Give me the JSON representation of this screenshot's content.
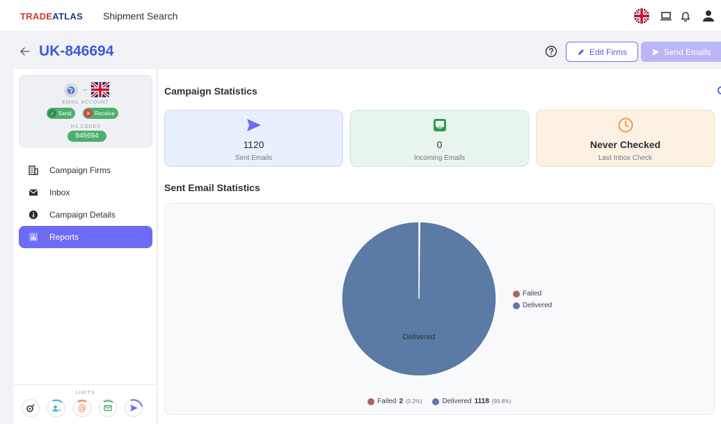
{
  "topbar": {
    "brand_part1": "TRADE",
    "brand_part2": "ATLAS",
    "title": "Shipment Search",
    "icons": [
      "uk-flag-icon",
      "laptop-icon",
      "bell-icon",
      "user-icon"
    ]
  },
  "header": {
    "campaign_name": "UK-846694",
    "edit_label": "Edit Firms",
    "send_label": "Send Emails"
  },
  "sidebar": {
    "email_account_label": "EMAIL ACCOUNT",
    "send_label": "Send",
    "receive_label": "Receive",
    "hs_codes_label": "HS CODES",
    "hs_code": "846694",
    "items": [
      {
        "label": "Campaign Firms",
        "icon": "building-icon"
      },
      {
        "label": "Inbox",
        "icon": "envelope-icon"
      },
      {
        "label": "Campaign Details",
        "icon": "info-icon"
      },
      {
        "label": "Reports",
        "icon": "report-chart-icon",
        "active": true
      }
    ],
    "limits_label": "LIMITS"
  },
  "main": {
    "stats_title": "Campaign Statistics",
    "cards": [
      {
        "value": "1120",
        "label": "Sent Emails",
        "icon": "paper-plane-icon"
      },
      {
        "value": "0",
        "label": "Incoming Emails",
        "icon": "inbox-icon"
      },
      {
        "value": "Never Checked",
        "label": "Last Inbox Check",
        "icon": "clock-icon"
      }
    ],
    "email_stats_title": "Sent Email Statistics"
  },
  "colors": {
    "accent": "#6d6af5",
    "failed": "#a8665a",
    "delivered": "#5b7ba6"
  },
  "chart_data": {
    "type": "pie",
    "title": "",
    "slices": [
      {
        "name": "Failed",
        "value": 2,
        "percent": "0.2%"
      },
      {
        "name": "Delivered",
        "value": 1118,
        "percent": "99.8%"
      }
    ],
    "slice_label": "Delivered",
    "legend": {
      "side": [
        "Failed",
        "Delivered"
      ],
      "bottom": [
        {
          "name": "Failed",
          "count": "2",
          "percent": "(0.2%)"
        },
        {
          "name": "Delivered",
          "count": "1118",
          "percent": "(99.8%)"
        }
      ]
    }
  }
}
